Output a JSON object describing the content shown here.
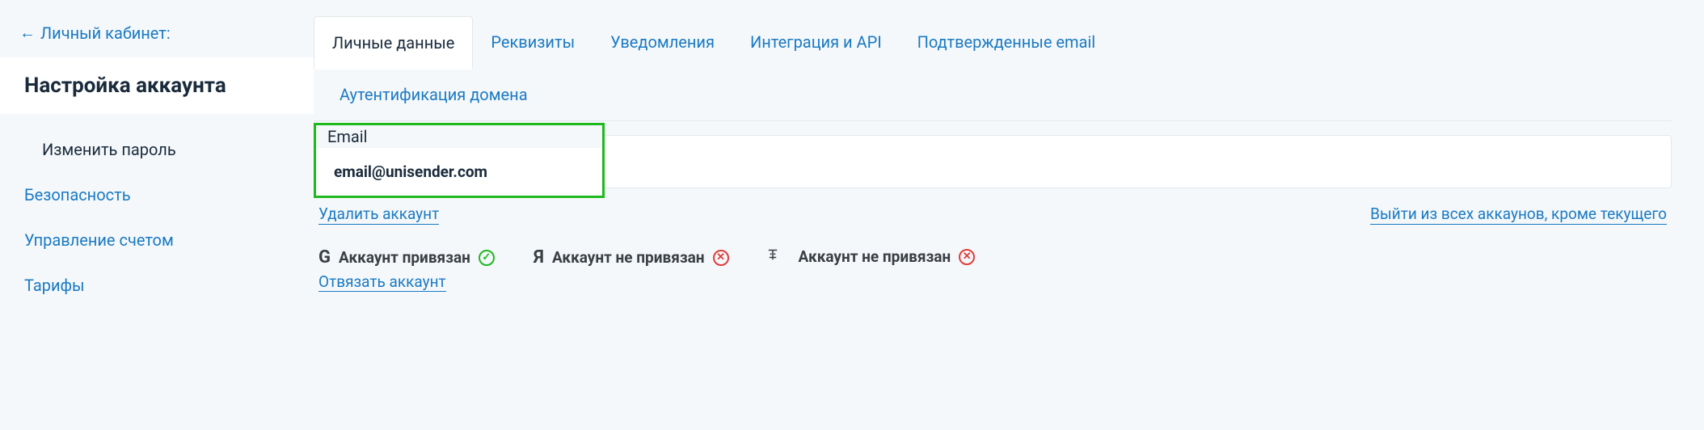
{
  "breadcrumb": {
    "label": "Личный кабинет:"
  },
  "page_title": "Настройка аккаунта",
  "sidebar": {
    "items": [
      {
        "label": "Изменить пароль"
      },
      {
        "label": "Безопасность"
      },
      {
        "label": "Управление счетом"
      },
      {
        "label": "Тарифы"
      }
    ]
  },
  "tabs": [
    {
      "label": "Личные данные",
      "active": true
    },
    {
      "label": "Реквизиты"
    },
    {
      "label": "Уведомления"
    },
    {
      "label": "Интеграция и API"
    },
    {
      "label": "Подтвержденные email"
    },
    {
      "label": "Аутентификация домена"
    }
  ],
  "email": {
    "label": "Email",
    "value": "email@unisender.com"
  },
  "links": {
    "delete": "Удалить аккаунт",
    "logout_others": "Выйти из всех аккаунов, кроме текущего"
  },
  "accounts": {
    "google": {
      "brand": "G",
      "status_label": "Аккаунт привязан",
      "linked": true,
      "unlink": "Отвязать аккаунт"
    },
    "yandex": {
      "brand": "Я",
      "status_label": "Аккаунт не привязан",
      "linked": false
    },
    "vk": {
      "brand": "VK",
      "status_label": "Аккаунт не привязан",
      "linked": false
    }
  }
}
